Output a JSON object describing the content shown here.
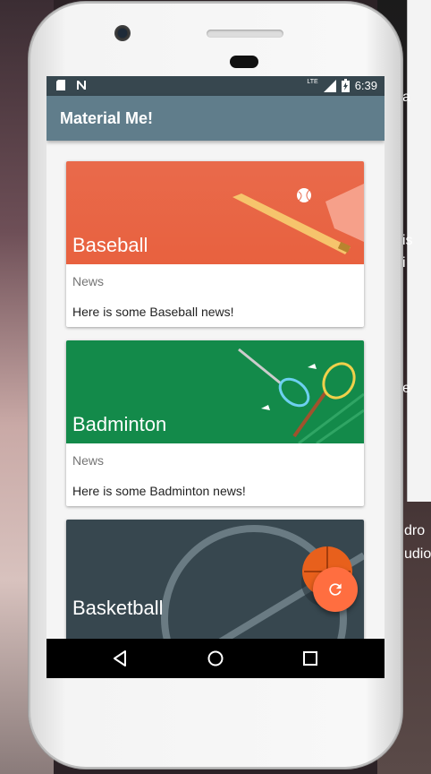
{
  "app": {
    "title": "Material Me!"
  },
  "status_bar": {
    "time": "6:39",
    "network": "LTE"
  },
  "cards": [
    {
      "title": "Baseball",
      "subtitle": "News",
      "info": "Here is some Baseball news!"
    },
    {
      "title": "Badminton",
      "subtitle": "News",
      "info": "Here is some Badminton news!"
    },
    {
      "title": "Basketball"
    }
  ],
  "fab": {
    "icon": "refresh-icon"
  },
  "nav": {
    "back": "back-icon",
    "home": "home-icon",
    "recents": "recents-icon"
  },
  "background_text": [
    "a",
    "is",
    "i",
    "e",
    "dro",
    "udio"
  ],
  "colors": {
    "appbar": "#607d8b",
    "statusbar": "#37474f",
    "fab": "#ff6e40",
    "baseball": "#e8613f",
    "badminton": "#138a4a",
    "basketball": "#37474f"
  }
}
